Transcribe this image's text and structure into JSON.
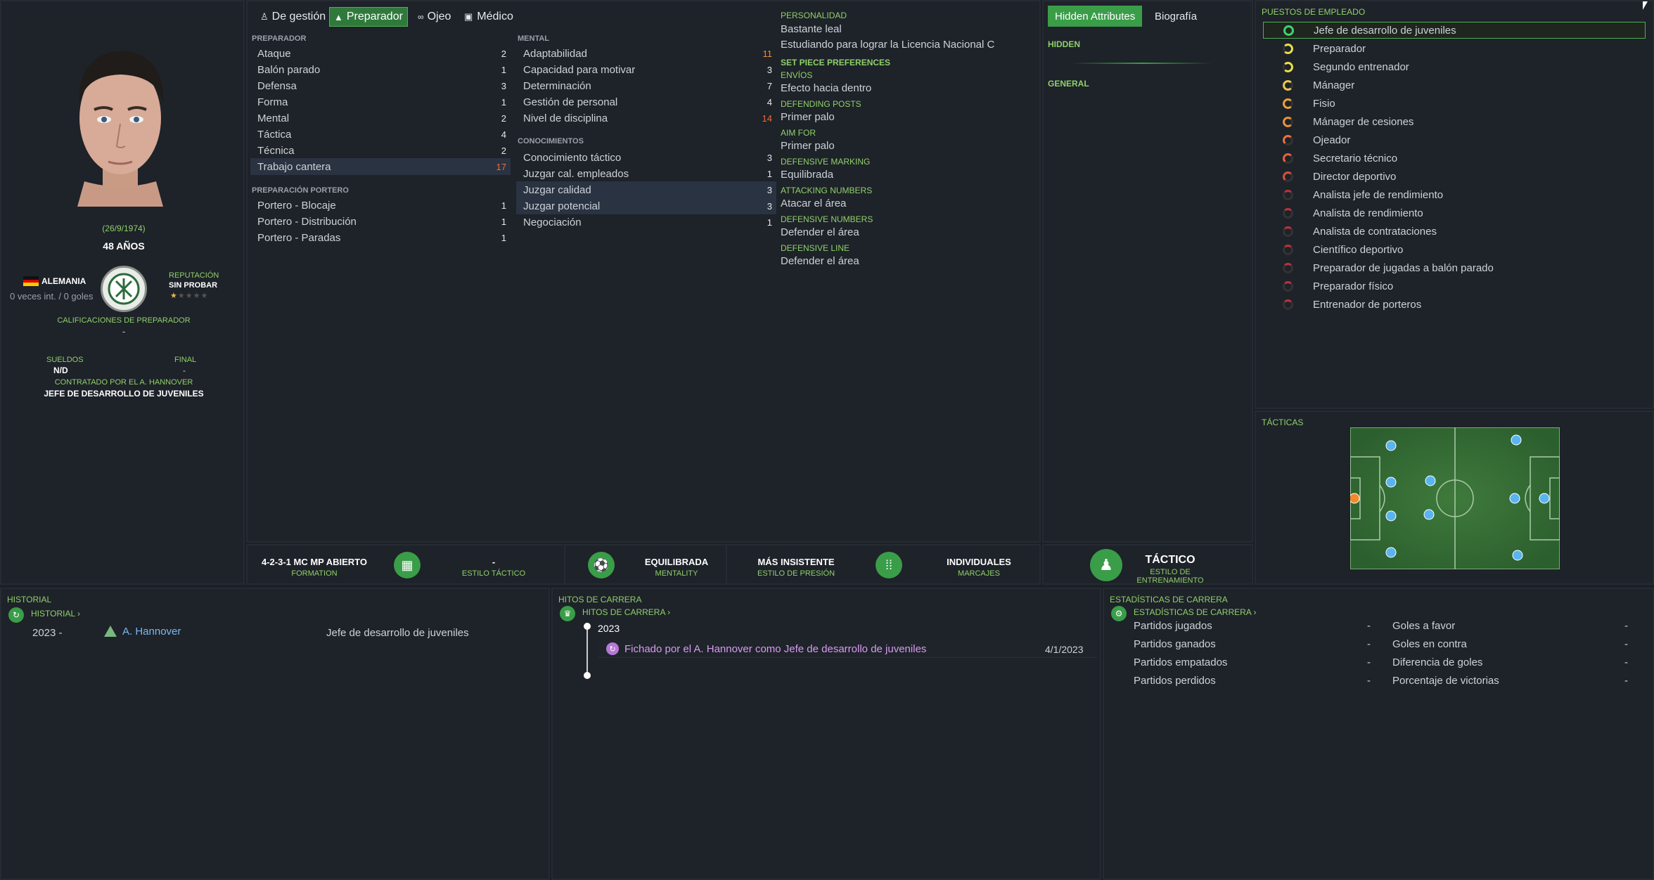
{
  "profile": {
    "dob": "(26/9/1974)",
    "age": "48 AÑOS",
    "nationality": "ALEMANIA",
    "caps": "0 veces int. / 0 goles",
    "reputation_label": "REPUTACIÓN",
    "reputation_value": "SIN PROBAR",
    "reputation_stars": 0.5,
    "coach_ratings_label": "CALIFICACIONES DE PREPARADOR",
    "coach_ratings_value": "-",
    "wages_label": "SUELDOS",
    "wages_value": "N/D",
    "end_label": "FINAL",
    "end_value": "-",
    "contracted_label": "CONTRATADO POR EL A. HANNOVER",
    "contracted_value": "JEFE DE DESARROLLO DE JUVENILES"
  },
  "tabs": [
    {
      "label": "De gestión",
      "icon": "person-icon"
    },
    {
      "label": "Preparador",
      "icon": "coach-icon"
    },
    {
      "label": "Ojeo",
      "icon": "binoculars-icon"
    },
    {
      "label": "Médico",
      "icon": "medkit-icon"
    }
  ],
  "sections": {
    "coaching_title": "PREPARADOR",
    "gk_title": "PREPARACIÓN PORTERO",
    "mental_title": "MENTAL",
    "knowledge_title": "CONOCIMIENTOS"
  },
  "coaching": [
    {
      "label": "Ataque",
      "value": "2"
    },
    {
      "label": "Balón parado",
      "value": "1"
    },
    {
      "label": "Defensa",
      "value": "3"
    },
    {
      "label": "Forma",
      "value": "1"
    },
    {
      "label": "Mental",
      "value": "2"
    },
    {
      "label": "Táctica",
      "value": "4"
    },
    {
      "label": "Técnica",
      "value": "2"
    },
    {
      "label": "Trabajo cantera",
      "value": "17"
    }
  ],
  "goalkeeping": [
    {
      "label": "Portero - Blocaje",
      "value": "1"
    },
    {
      "label": "Portero - Distribución",
      "value": "1"
    },
    {
      "label": "Portero - Paradas",
      "value": "1"
    }
  ],
  "mental": [
    {
      "label": "Adaptabilidad",
      "value": "11"
    },
    {
      "label": "Capacidad para motivar",
      "value": "3"
    },
    {
      "label": "Determinación",
      "value": "7"
    },
    {
      "label": "Gestión de personal",
      "value": "4"
    },
    {
      "label": "Nivel de disciplina",
      "value": "14"
    }
  ],
  "knowledge": [
    {
      "label": "Conocimiento táctico",
      "value": "3"
    },
    {
      "label": "Juzgar cal. empleados",
      "value": "1"
    },
    {
      "label": "Juzgar calidad",
      "value": "3"
    },
    {
      "label": "Juzgar potencial",
      "value": "3"
    },
    {
      "label": "Negociación",
      "value": "1"
    }
  ],
  "personality": [
    {
      "h": "PERSONALIDAD",
      "v": "Bastante leal"
    },
    {
      "h": "",
      "v": "Estudiando para lograr la Licencia Nacional C"
    },
    {
      "h": "SET PIECE PREFERENCES",
      "v": ""
    },
    {
      "h": "ENVÍOS",
      "v": "Efecto hacia dentro"
    },
    {
      "h": "DEFENDING POSTS",
      "v": "Primer palo"
    },
    {
      "h": "AIM FOR",
      "v": "Primer palo"
    },
    {
      "h": "DEFENSIVE MARKING",
      "v": "Equilibrada"
    },
    {
      "h": "ATTACKING NUMBERS",
      "v": "Atacar el área"
    },
    {
      "h": "DEFENSIVE NUMBERS",
      "v": "Defender el área"
    },
    {
      "h": "DEFENSIVE LINE",
      "v": "Defender el área"
    }
  ],
  "hidden_panel": {
    "tab_active": "Hidden Attributes",
    "tab_other": "Biografía",
    "hidden": "HIDDEN",
    "general": "GENERAL"
  },
  "roles_title": "PUESTOS DE EMPLEADO",
  "roles": [
    {
      "label": "Jefe de desarrollo de juveniles",
      "color": "#3fd36a"
    },
    {
      "label": "Preparador",
      "color": "#e8e04a"
    },
    {
      "label": "Segundo entrenador",
      "color": "#e8e04a"
    },
    {
      "label": "Mánager",
      "color": "#e8c84a"
    },
    {
      "label": "Fisio",
      "color": "#e8a03a"
    },
    {
      "label": "Mánager de cesiones",
      "color": "#e8903a"
    },
    {
      "label": "Ojeador",
      "color": "#e8703a"
    },
    {
      "label": "Secretario técnico",
      "color": "#e8603a"
    },
    {
      "label": "Director deportivo",
      "color": "#d8503a"
    },
    {
      "label": "Analista jefe de rendimiento",
      "color": "#c0303a"
    },
    {
      "label": "Analista de rendimiento",
      "color": "#c0303a"
    },
    {
      "label": "Analista de contrataciones",
      "color": "#c0303a"
    },
    {
      "label": "Científico deportivo",
      "color": "#c0303a"
    },
    {
      "label": "Preparador de jugadas a balón parado",
      "color": "#c0303a"
    },
    {
      "label": "Preparador físico",
      "color": "#c0303a"
    },
    {
      "label": "Entrenador de porteros",
      "color": "#c0303a"
    }
  ],
  "tactics_title": "TÁCTICAS",
  "bottom": {
    "formation": "4-2-3-1 MC MP ABIERTO",
    "formation_sub": "FORMATION",
    "style": "-",
    "style_sub": "ESTILO TÁCTICO",
    "mentality": "EQUILIBRADA",
    "mentality_sub": "MENTALITY",
    "pressing": "MÁS INSISTENTE",
    "pressing_sub": "ESTILO DE PRESIÓN",
    "marking": "INDIVIDUALES",
    "marking_sub": "MARCAJES",
    "training": "TÁCTICO",
    "training_sub": "ESTILO DE ENTRENAMIENTO"
  },
  "history": {
    "title": "HISTORIAL",
    "link": "HISTORIAL ›",
    "year": "2023 -",
    "club": "A. Hannover",
    "role": "Jefe de desarrollo de juveniles"
  },
  "milestones": {
    "title": "HITOS DE CARRERA",
    "link": "HITOS DE CARRERA ›",
    "year": "2023",
    "event": "Fichado por el A. Hannover como Jefe de desarrollo de juveniles",
    "date": "4/1/2023"
  },
  "career_stats": {
    "title": "ESTADÍSTICAS DE CARRERA",
    "link": "ESTADÍSTICAS DE CARRERA ›",
    "left": [
      {
        "label": "Partidos jugados",
        "value": "-"
      },
      {
        "label": "Partidos ganados",
        "value": "-"
      },
      {
        "label": "Partidos empatados",
        "value": "-"
      },
      {
        "label": "Partidos perdidos",
        "value": "-"
      }
    ],
    "right": [
      {
        "label": "Goles a favor",
        "value": "-"
      },
      {
        "label": "Goles en contra",
        "value": "-"
      },
      {
        "label": "Diferencia de goles",
        "value": "-"
      },
      {
        "label": "Porcentaje de victorias",
        "value": "-"
      }
    ]
  }
}
